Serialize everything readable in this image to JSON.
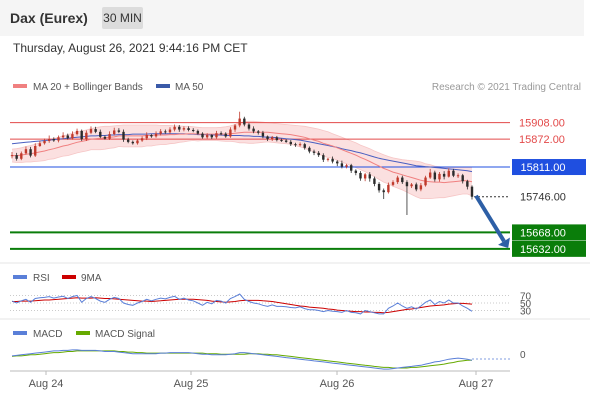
{
  "header": {
    "title": "Dax (Eurex)",
    "timeframe": "30 MIN",
    "datetime": "Thursday, August 26, 2021 9:44:16 PM CET"
  },
  "legend": {
    "ma20_label": "MA 20 + Bollinger Bands",
    "ma50_label": "MA 50",
    "copyright": "Research © 2021 Trading Central",
    "rsi_label": "RSI",
    "rsi_ma_label": "9MA",
    "macd_label": "MACD",
    "macd_signal_label": "MACD Signal"
  },
  "colors": {
    "candle_up": "#c0392b",
    "candle_down": "#2b2b2b",
    "ma20": "#f08080",
    "bollinger_fill": "#fbe0e0",
    "ma50": "#4a5fc1",
    "resistance": "#e34a4a",
    "pivot": "#1f4fe0",
    "support": "#0a7d0a",
    "current_price": "#333333",
    "arrow": "#2d5fa6",
    "rsi": "#5a7fd8",
    "rsi_ma": "#cc0000",
    "macd": "#5a7fd8",
    "macd_signal": "#66aa00"
  },
  "chart_data": {
    "type": "candlestick",
    "instrument": "Dax (Eurex)",
    "interval": "30 MIN",
    "x_ticks": [
      "Aug 24",
      "Aug 25",
      "Aug 26",
      "Aug 27"
    ],
    "y_range": [
      15612,
      15962
    ],
    "key_levels": [
      {
        "label": "15908.00",
        "value": 15908,
        "kind": "resistance"
      },
      {
        "label": "15872.00",
        "value": 15872,
        "kind": "resistance"
      },
      {
        "label": "15811.00",
        "value": 15811,
        "kind": "pivot"
      },
      {
        "label": "15746.00",
        "value": 15746,
        "kind": "current"
      },
      {
        "label": "15668.00",
        "value": 15668,
        "kind": "support"
      },
      {
        "label": "15632.00",
        "value": 15632,
        "kind": "support"
      }
    ],
    "projection": {
      "from": 15746,
      "to": 15640,
      "direction": "down"
    },
    "closes": [
      15837,
      15829,
      15841,
      15850,
      15836,
      15857,
      15863,
      15868,
      15872,
      15869,
      15876,
      15880,
      15874,
      15883,
      15890,
      15872,
      15886,
      15894,
      15888,
      15877,
      15873,
      15883,
      15891,
      15888,
      15871,
      15866,
      15863,
      15869,
      15874,
      15881,
      15878,
      15884,
      15889,
      15887,
      15893,
      15899,
      15893,
      15896,
      15892,
      15890,
      15884,
      15876,
      15881,
      15876,
      15885,
      15884,
      15878,
      15893,
      15902,
      15917,
      15904,
      15895,
      15889,
      15886,
      15878,
      15872,
      15876,
      15870,
      15869,
      15866,
      15861,
      15859,
      15861,
      15853,
      15845,
      15842,
      15837,
      15827,
      15829,
      15823,
      15819,
      15812,
      15815,
      15803,
      15798,
      15786,
      15795,
      15786,
      15774,
      15760,
      15756,
      15772,
      15778,
      15788,
      15778,
      15769,
      15773,
      15762,
      15771,
      15788,
      15799,
      15784,
      15796,
      15790,
      15803,
      15792,
      15793,
      15780,
      15768,
      15746
    ],
    "opens": [
      15835,
      15837,
      15829,
      15841,
      15850,
      15836,
      15857,
      15863,
      15868,
      15872,
      15869,
      15876,
      15880,
      15874,
      15883,
      15890,
      15872,
      15886,
      15894,
      15888,
      15877,
      15873,
      15883,
      15891,
      15888,
      15871,
      15866,
      15863,
      15869,
      15874,
      15881,
      15878,
      15884,
      15889,
      15887,
      15893,
      15899,
      15893,
      15896,
      15892,
      15890,
      15884,
      15876,
      15881,
      15876,
      15885,
      15884,
      15878,
      15893,
      15902,
      15917,
      15904,
      15895,
      15889,
      15886,
      15878,
      15872,
      15876,
      15870,
      15869,
      15866,
      15861,
      15859,
      15861,
      15853,
      15845,
      15842,
      15837,
      15827,
      15829,
      15823,
      15819,
      15812,
      15815,
      15803,
      15798,
      15786,
      15795,
      15786,
      15774,
      15760,
      15756,
      15772,
      15778,
      15788,
      15778,
      15769,
      15773,
      15762,
      15771,
      15788,
      15799,
      15784,
      15796,
      15790,
      15803,
      15792,
      15793,
      15780,
      15768
    ],
    "highs": [
      15844,
      15842,
      15845,
      15856,
      15855,
      15863,
      15869,
      15873,
      15880,
      15876,
      15880,
      15887,
      15884,
      15889,
      15895,
      15893,
      15891,
      15900,
      15899,
      15893,
      15880,
      15889,
      15897,
      15896,
      15893,
      15875,
      15869,
      15872,
      15878,
      15887,
      15883,
      15889,
      15894,
      15893,
      15898,
      15904,
      15903,
      15900,
      15900,
      15896,
      15893,
      15887,
      15885,
      15883,
      15890,
      15889,
      15887,
      15898,
      15905,
      15932,
      15921,
      15907,
      15900,
      15892,
      15890,
      15880,
      15879,
      15879,
      15873,
      15872,
      15870,
      15864,
      15865,
      15864,
      15856,
      15849,
      15846,
      15841,
      15831,
      15834,
      15826,
      15825,
      15818,
      15818,
      15806,
      15802,
      15798,
      15800,
      15790,
      15778,
      15764,
      15777,
      15782,
      15792,
      15792,
      15782,
      15776,
      15777,
      15776,
      15792,
      15807,
      15803,
      15800,
      15802,
      15808,
      15807,
      15797,
      15796,
      15783,
      15771
    ],
    "lows": [
      15830,
      15825,
      15826,
      15838,
      15832,
      15833,
      15855,
      15860,
      15864,
      15866,
      15865,
      15872,
      15871,
      15871,
      15880,
      15868,
      15868,
      15883,
      15885,
      15874,
      15871,
      15870,
      15880,
      15885,
      15866,
      15863,
      15860,
      15860,
      15866,
      15870,
      15875,
      15875,
      15880,
      15884,
      15884,
      15889,
      15888,
      15889,
      15889,
      15887,
      15882,
      15873,
      15873,
      15872,
      15873,
      15880,
      15875,
      15875,
      15888,
      15898,
      15900,
      15891,
      15885,
      15882,
      15874,
      15868,
      15868,
      15867,
      15866,
      15864,
      15857,
      15855,
      15856,
      15849,
      15841,
      15837,
      15833,
      15822,
      15823,
      15819,
      15813,
      15808,
      15808,
      15798,
      15793,
      15781,
      15780,
      15779,
      15769,
      15755,
      15741,
      15753,
      15769,
      15774,
      15774,
      15706,
      15765,
      15758,
      15758,
      15768,
      15785,
      15779,
      15779,
      15784,
      15788,
      15789,
      15787,
      15775,
      15762,
      15740
    ],
    "ma20": [
      15836,
      15836,
      15837,
      15839,
      15840,
      15842,
      15844,
      15846,
      15849,
      15851,
      15854,
      15857,
      15859,
      15862,
      15865,
      15867,
      15869,
      15872,
      15873,
      15874,
      15875,
      15876,
      15877,
      15879,
      15879,
      15879,
      15879,
      15879,
      15879,
      15880,
      15880,
      15881,
      15881,
      15881,
      15882,
      15882,
      15883,
      15883,
      15884,
      15884,
      15883,
      15883,
      15883,
      15883,
      15883,
      15883,
      15883,
      15884,
      15885,
      15886,
      15887,
      15887,
      15887,
      15887,
      15887,
      15887,
      15886,
      15885,
      15884,
      15883,
      15882,
      15880,
      15878,
      15876,
      15873,
      15870,
      15867,
      15863,
      15860,
      15857,
      15853,
      15849,
      15845,
      15841,
      15837,
      15832,
      15828,
      15823,
      15818,
      15813,
      15808,
      15804,
      15800,
      15797,
      15794,
      15791,
      15788,
      15785,
      15782,
      15780,
      15779,
      15778,
      15778,
      15777,
      15778,
      15779,
      15780,
      15781,
      15781,
      15779
    ],
    "bb_upper": [
      15850,
      15851,
      15853,
      15856,
      15858,
      15861,
      15864,
      15867,
      15870,
      15873,
      15876,
      15879,
      15882,
      15885,
      15888,
      15890,
      15892,
      15895,
      15897,
      15899,
      15900,
      15900,
      15901,
      15902,
      15903,
      15903,
      15903,
      15903,
      15903,
      15903,
      15903,
      15903,
      15902,
      15902,
      15902,
      15901,
      15901,
      15900,
      15900,
      15899,
      15898,
      15897,
      15897,
      15897,
      15897,
      15898,
      15899,
      15901,
      15904,
      15908,
      15910,
      15911,
      15911,
      15910,
      15909,
      15908,
      15907,
      15906,
      15905,
      15904,
      15903,
      15902,
      15901,
      15900,
      15898,
      15896,
      15894,
      15891,
      15888,
      15884,
      15880,
      15876,
      15872,
      15868,
      15864,
      15859,
      15855,
      15851,
      15846,
      15842,
      15838,
      15834,
      15831,
      15829,
      15827,
      15826,
      15825,
      15824,
      15822,
      15818,
      15816,
      15813,
      15812,
      15810,
      15810,
      15810,
      15810,
      15810,
      15810,
      15810
    ],
    "bb_lower": [
      15822,
      15821,
      15821,
      15822,
      15822,
      15823,
      15824,
      15825,
      15828,
      15829,
      15832,
      15835,
      15836,
      15839,
      15842,
      15844,
      15846,
      15849,
      15849,
      15849,
      15850,
      15852,
      15853,
      15856,
      15855,
      15855,
      15855,
      15855,
      15855,
      15857,
      15857,
      15859,
      15860,
      15860,
      15862,
      15863,
      15865,
      15866,
      15868,
      15869,
      15868,
      15869,
      15869,
      15869,
      15869,
      15868,
      15867,
      15867,
      15866,
      15864,
      15864,
      15863,
      15863,
      15864,
      15865,
      15866,
      15865,
      15864,
      15863,
      15862,
      15861,
      15858,
      15855,
      15852,
      15848,
      15844,
      15840,
      15835,
      15832,
      15830,
      15826,
      15822,
      15818,
      15814,
      15810,
      15805,
      15801,
      15795,
      15790,
      15784,
      15778,
      15774,
      15769,
      15765,
      15761,
      15756,
      15751,
      15746,
      15742,
      15742,
      15742,
      15743,
      15744,
      15744,
      15746,
      15748,
      15750,
      15752,
      15752,
      15748
    ],
    "ma50": [
      15862,
      15863,
      15864,
      15865,
      15866,
      15867,
      15868,
      15869,
      15870,
      15871,
      15872,
      15873,
      15874,
      15875,
      15876,
      15877,
      15878,
      15879,
      15879,
      15880,
      15880,
      15881,
      15881,
      15882,
      15882,
      15882,
      15883,
      15883,
      15883,
      15883,
      15884,
      15884,
      15884,
      15884,
      15884,
      15884,
      15884,
      15884,
      15883,
      15883,
      15882,
      15882,
      15882,
      15881,
      15881,
      15881,
      15880,
      15880,
      15880,
      15880,
      15879,
      15879,
      15878,
      15878,
      15877,
      15876,
      15876,
      15875,
      15874,
      15873,
      15872,
      15871,
      15870,
      15868,
      15866,
      15864,
      15862,
      15860,
      15858,
      15856,
      15854,
      15851,
      15849,
      15847,
      15844,
      15842,
      15839,
      15836,
      15833,
      15830,
      15828,
      15826,
      15824,
      15822,
      15820,
      15818,
      15816,
      15814,
      15813,
      15812,
      15811,
      15810,
      15809,
      15808,
      15807,
      15806,
      15805,
      15804,
      15803,
      15801
    ],
    "rsi": {
      "levels": [
        "70",
        "50",
        "30"
      ],
      "values": [
        55,
        50,
        56,
        60,
        52,
        62,
        64,
        65,
        67,
        63,
        66,
        68,
        62,
        67,
        70,
        52,
        62,
        67,
        62,
        55,
        52,
        60,
        65,
        62,
        50,
        46,
        44,
        50,
        54,
        60,
        56,
        60,
        63,
        61,
        65,
        68,
        60,
        63,
        58,
        56,
        50,
        44,
        52,
        48,
        57,
        55,
        50,
        62,
        67,
        74,
        60,
        54,
        50,
        48,
        44,
        41,
        45,
        41,
        41,
        40,
        38,
        37,
        40,
        35,
        32,
        32,
        30,
        27,
        30,
        28,
        27,
        25,
        30,
        25,
        24,
        21,
        30,
        27,
        24,
        21,
        21,
        36,
        42,
        50,
        42,
        36,
        40,
        34,
        42,
        52,
        58,
        46,
        54,
        50,
        58,
        50,
        50,
        42,
        36,
        28
      ],
      "ma9": [
        54,
        54,
        55,
        55,
        55,
        56,
        57,
        58,
        58,
        59,
        60,
        61,
        62,
        63,
        64,
        63,
        63,
        63,
        64,
        63,
        62,
        62,
        61,
        60,
        59,
        58,
        57,
        56,
        55,
        55,
        54,
        55,
        56,
        57,
        58,
        59,
        60,
        60,
        60,
        60,
        59,
        58,
        57,
        55,
        54,
        53,
        52,
        53,
        54,
        56,
        57,
        57,
        57,
        57,
        56,
        55,
        54,
        52,
        50,
        48,
        46,
        44,
        42,
        41,
        39,
        38,
        37,
        36,
        34,
        33,
        31,
        30,
        29,
        28,
        27,
        27,
        26,
        26,
        25,
        25,
        24,
        25,
        27,
        29,
        31,
        33,
        34,
        36,
        38,
        40,
        42,
        43,
        44,
        45,
        47,
        48,
        49,
        49,
        48,
        47
      ]
    },
    "macd": {
      "zero_label": "0",
      "macd": [
        2,
        3,
        4,
        5,
        6,
        7,
        8,
        9,
        10,
        11,
        11,
        12,
        12,
        13,
        13,
        12,
        12,
        12,
        12,
        11,
        10,
        10,
        10,
        9,
        8,
        7,
        6,
        6,
        6,
        6,
        6,
        6,
        7,
        7,
        8,
        8,
        8,
        8,
        8,
        7,
        6,
        5,
        5,
        4,
        4,
        4,
        4,
        5,
        6,
        8,
        8,
        7,
        6,
        5,
        4,
        3,
        2,
        1,
        0,
        -1,
        -2,
        -3,
        -4,
        -5,
        -6,
        -7,
        -8,
        -9,
        -10,
        -11,
        -12,
        -13,
        -14,
        -15,
        -16,
        -17,
        -18,
        -19,
        -20,
        -21,
        -22,
        -22,
        -21,
        -20,
        -19,
        -18,
        -17,
        -16,
        -15,
        -13,
        -11,
        -9,
        -8,
        -6,
        -4,
        -3,
        -2,
        -3,
        -4,
        -6
      ],
      "signal": [
        1,
        2,
        2,
        3,
        4,
        4,
        5,
        6,
        7,
        8,
        8,
        9,
        10,
        10,
        11,
        11,
        11,
        11,
        11,
        11,
        11,
        11,
        11,
        10,
        10,
        9,
        9,
        8,
        8,
        7,
        7,
        7,
        7,
        7,
        7,
        7,
        7,
        7,
        7,
        7,
        7,
        7,
        6,
        6,
        6,
        5,
        5,
        5,
        5,
        5,
        5,
        6,
        6,
        6,
        5,
        5,
        4,
        4,
        3,
        2,
        1,
        0,
        -1,
        -2,
        -3,
        -4,
        -5,
        -6,
        -7,
        -8,
        -9,
        -10,
        -11,
        -12,
        -13,
        -14,
        -15,
        -16,
        -17,
        -18,
        -19,
        -19,
        -20,
        -20,
        -20,
        -20,
        -19,
        -19,
        -18,
        -17,
        -16,
        -15,
        -14,
        -13,
        -11,
        -10,
        -8,
        -7,
        -6,
        -6
      ]
    }
  }
}
